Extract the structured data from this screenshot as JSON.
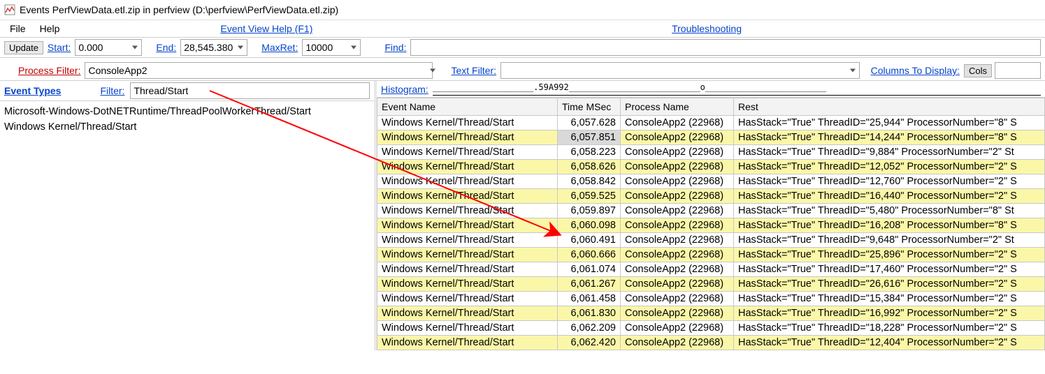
{
  "window": {
    "title": "Events PerfViewData.etl.zip in perfview (D:\\perfview\\PerfViewData.etl.zip)"
  },
  "menu": {
    "file": "File",
    "help": "Help",
    "event_view_help": "Event View Help (F1)",
    "troubleshooting": "Troubleshooting"
  },
  "toolbar": {
    "update": "Update",
    "start_label": "Start:",
    "start_value": "0.000",
    "end_label": "End:",
    "end_value": "28,545.380",
    "maxret_label": "MaxRet:",
    "maxret_value": "10000",
    "find_label": "Find:",
    "find_value": ""
  },
  "filters": {
    "process_filter_label": "Process Filter:",
    "process_filter_value": "ConsoleApp2",
    "text_filter_label": "Text Filter:",
    "text_filter_value": "",
    "columns_label": "Columns To Display:",
    "cols_btn": "Cols"
  },
  "left": {
    "event_types_label": "Event Types",
    "filter_label": "Filter:",
    "filter_value": "Thread/Start",
    "items": [
      "Microsoft-Windows-DotNETRuntime/ThreadPoolWorkerThread/Start",
      "Windows Kernel/Thread/Start"
    ]
  },
  "right": {
    "histogram_label": "Histogram:",
    "histogram_value": "____________________.59A992__________________________o________________________",
    "columns": {
      "event": "Event Name",
      "time": "Time MSec",
      "process": "Process Name",
      "rest": "Rest"
    },
    "rows": [
      {
        "event": "Windows Kernel/Thread/Start",
        "time": "6,057.628",
        "process": "ConsoleApp2 (22968)",
        "rest": "HasStack=\"True\" ThreadID=\"25,944\" ProcessorNumber=\"8\" S"
      },
      {
        "event": "Windows Kernel/Thread/Start",
        "time": "6,057.851",
        "process": "ConsoleApp2 (22968)",
        "rest": "HasStack=\"True\" ThreadID=\"14,244\" ProcessorNumber=\"8\" S"
      },
      {
        "event": "Windows Kernel/Thread/Start",
        "time": "6,058.223",
        "process": "ConsoleApp2 (22968)",
        "rest": "HasStack=\"True\" ThreadID=\"9,884\" ProcessorNumber=\"2\" St"
      },
      {
        "event": "Windows Kernel/Thread/Start",
        "time": "6,058.626",
        "process": "ConsoleApp2 (22968)",
        "rest": "HasStack=\"True\" ThreadID=\"12,052\" ProcessorNumber=\"2\" S"
      },
      {
        "event": "Windows Kernel/Thread/Start",
        "time": "6,058.842",
        "process": "ConsoleApp2 (22968)",
        "rest": "HasStack=\"True\" ThreadID=\"12,760\" ProcessorNumber=\"2\" S"
      },
      {
        "event": "Windows Kernel/Thread/Start",
        "time": "6,059.525",
        "process": "ConsoleApp2 (22968)",
        "rest": "HasStack=\"True\" ThreadID=\"16,440\" ProcessorNumber=\"2\" S"
      },
      {
        "event": "Windows Kernel/Thread/Start",
        "time": "6,059.897",
        "process": "ConsoleApp2 (22968)",
        "rest": "HasStack=\"True\" ThreadID=\"5,480\" ProcessorNumber=\"8\" St"
      },
      {
        "event": "Windows Kernel/Thread/Start",
        "time": "6,060.098",
        "process": "ConsoleApp2 (22968)",
        "rest": "HasStack=\"True\" ThreadID=\"16,208\" ProcessorNumber=\"8\" S"
      },
      {
        "event": "Windows Kernel/Thread/Start",
        "time": "6,060.491",
        "process": "ConsoleApp2 (22968)",
        "rest": "HasStack=\"True\" ThreadID=\"9,648\" ProcessorNumber=\"2\" St"
      },
      {
        "event": "Windows Kernel/Thread/Start",
        "time": "6,060.666",
        "process": "ConsoleApp2 (22968)",
        "rest": "HasStack=\"True\" ThreadID=\"25,896\" ProcessorNumber=\"2\" S"
      },
      {
        "event": "Windows Kernel/Thread/Start",
        "time": "6,061.074",
        "process": "ConsoleApp2 (22968)",
        "rest": "HasStack=\"True\" ThreadID=\"17,460\" ProcessorNumber=\"2\" S"
      },
      {
        "event": "Windows Kernel/Thread/Start",
        "time": "6,061.267",
        "process": "ConsoleApp2 (22968)",
        "rest": "HasStack=\"True\" ThreadID=\"26,616\" ProcessorNumber=\"2\" S"
      },
      {
        "event": "Windows Kernel/Thread/Start",
        "time": "6,061.458",
        "process": "ConsoleApp2 (22968)",
        "rest": "HasStack=\"True\" ThreadID=\"15,384\" ProcessorNumber=\"2\" S"
      },
      {
        "event": "Windows Kernel/Thread/Start",
        "time": "6,061.830",
        "process": "ConsoleApp2 (22968)",
        "rest": "HasStack=\"True\" ThreadID=\"16,992\" ProcessorNumber=\"2\" S"
      },
      {
        "event": "Windows Kernel/Thread/Start",
        "time": "6,062.209",
        "process": "ConsoleApp2 (22968)",
        "rest": "HasStack=\"True\" ThreadID=\"18,228\" ProcessorNumber=\"2\" S"
      },
      {
        "event": "Windows Kernel/Thread/Start",
        "time": "6,062.420",
        "process": "ConsoleApp2 (22968)",
        "rest": "HasStack=\"True\" ThreadID=\"12,404\" ProcessorNumber=\"2\" S"
      }
    ]
  }
}
